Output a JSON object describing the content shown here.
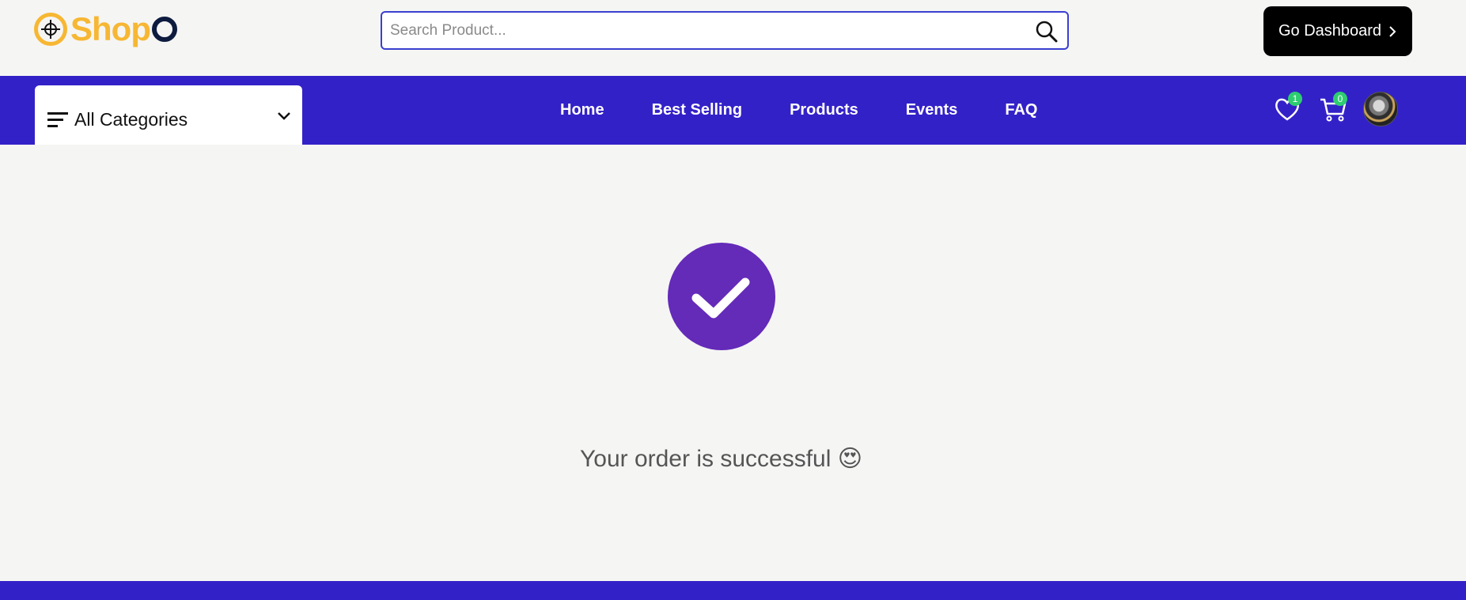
{
  "header": {
    "logo_text": "Shop",
    "logo_last": "O",
    "search_placeholder": "Search Product...",
    "dashboard_button": "Go Dashboard"
  },
  "nav": {
    "categories_label": "All Categories",
    "links": [
      "Home",
      "Best Selling",
      "Products",
      "Events",
      "FAQ"
    ],
    "wishlist_count": "1",
    "cart_count": "0"
  },
  "main": {
    "message": "Your order is successful",
    "emoji": "😍"
  },
  "colors": {
    "nav_bg": "#3321c8",
    "success": "#642ab8",
    "brand": "#f7b733",
    "badge": "#2ecc71"
  }
}
